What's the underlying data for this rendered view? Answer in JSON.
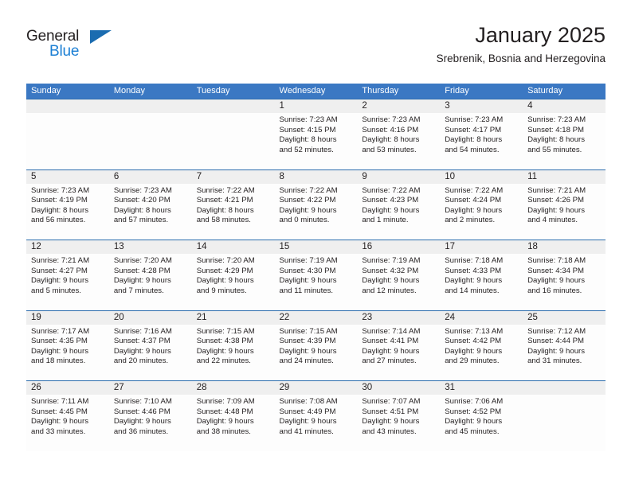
{
  "brand": {
    "name_part1": "General",
    "name_part2": "Blue",
    "accent_color": "#1b7fd4",
    "triangle_color": "#1b6cb0"
  },
  "header": {
    "month_title": "January 2025",
    "location": "Srebrenik, Bosnia and Herzegovina"
  },
  "theme": {
    "header_blue": "#3b78c3",
    "rule_blue": "#2b6cad",
    "daynum_band": "#efefef"
  },
  "weekdays": [
    "Sunday",
    "Monday",
    "Tuesday",
    "Wednesday",
    "Thursday",
    "Friday",
    "Saturday"
  ],
  "weeks": [
    {
      "days": [
        {
          "num": "",
          "lines": [
            "",
            "",
            "",
            ""
          ]
        },
        {
          "num": "",
          "lines": [
            "",
            "",
            "",
            ""
          ]
        },
        {
          "num": "",
          "lines": [
            "",
            "",
            "",
            ""
          ]
        },
        {
          "num": "1",
          "lines": [
            "Sunrise: 7:23 AM",
            "Sunset: 4:15 PM",
            "Daylight: 8 hours",
            "and 52 minutes."
          ]
        },
        {
          "num": "2",
          "lines": [
            "Sunrise: 7:23 AM",
            "Sunset: 4:16 PM",
            "Daylight: 8 hours",
            "and 53 minutes."
          ]
        },
        {
          "num": "3",
          "lines": [
            "Sunrise: 7:23 AM",
            "Sunset: 4:17 PM",
            "Daylight: 8 hours",
            "and 54 minutes."
          ]
        },
        {
          "num": "4",
          "lines": [
            "Sunrise: 7:23 AM",
            "Sunset: 4:18 PM",
            "Daylight: 8 hours",
            "and 55 minutes."
          ]
        }
      ]
    },
    {
      "days": [
        {
          "num": "5",
          "lines": [
            "Sunrise: 7:23 AM",
            "Sunset: 4:19 PM",
            "Daylight: 8 hours",
            "and 56 minutes."
          ]
        },
        {
          "num": "6",
          "lines": [
            "Sunrise: 7:23 AM",
            "Sunset: 4:20 PM",
            "Daylight: 8 hours",
            "and 57 minutes."
          ]
        },
        {
          "num": "7",
          "lines": [
            "Sunrise: 7:22 AM",
            "Sunset: 4:21 PM",
            "Daylight: 8 hours",
            "and 58 minutes."
          ]
        },
        {
          "num": "8",
          "lines": [
            "Sunrise: 7:22 AM",
            "Sunset: 4:22 PM",
            "Daylight: 9 hours",
            "and 0 minutes."
          ]
        },
        {
          "num": "9",
          "lines": [
            "Sunrise: 7:22 AM",
            "Sunset: 4:23 PM",
            "Daylight: 9 hours",
            "and 1 minute."
          ]
        },
        {
          "num": "10",
          "lines": [
            "Sunrise: 7:22 AM",
            "Sunset: 4:24 PM",
            "Daylight: 9 hours",
            "and 2 minutes."
          ]
        },
        {
          "num": "11",
          "lines": [
            "Sunrise: 7:21 AM",
            "Sunset: 4:26 PM",
            "Daylight: 9 hours",
            "and 4 minutes."
          ]
        }
      ]
    },
    {
      "days": [
        {
          "num": "12",
          "lines": [
            "Sunrise: 7:21 AM",
            "Sunset: 4:27 PM",
            "Daylight: 9 hours",
            "and 5 minutes."
          ]
        },
        {
          "num": "13",
          "lines": [
            "Sunrise: 7:20 AM",
            "Sunset: 4:28 PM",
            "Daylight: 9 hours",
            "and 7 minutes."
          ]
        },
        {
          "num": "14",
          "lines": [
            "Sunrise: 7:20 AM",
            "Sunset: 4:29 PM",
            "Daylight: 9 hours",
            "and 9 minutes."
          ]
        },
        {
          "num": "15",
          "lines": [
            "Sunrise: 7:19 AM",
            "Sunset: 4:30 PM",
            "Daylight: 9 hours",
            "and 11 minutes."
          ]
        },
        {
          "num": "16",
          "lines": [
            "Sunrise: 7:19 AM",
            "Sunset: 4:32 PM",
            "Daylight: 9 hours",
            "and 12 minutes."
          ]
        },
        {
          "num": "17",
          "lines": [
            "Sunrise: 7:18 AM",
            "Sunset: 4:33 PM",
            "Daylight: 9 hours",
            "and 14 minutes."
          ]
        },
        {
          "num": "18",
          "lines": [
            "Sunrise: 7:18 AM",
            "Sunset: 4:34 PM",
            "Daylight: 9 hours",
            "and 16 minutes."
          ]
        }
      ]
    },
    {
      "days": [
        {
          "num": "19",
          "lines": [
            "Sunrise: 7:17 AM",
            "Sunset: 4:35 PM",
            "Daylight: 9 hours",
            "and 18 minutes."
          ]
        },
        {
          "num": "20",
          "lines": [
            "Sunrise: 7:16 AM",
            "Sunset: 4:37 PM",
            "Daylight: 9 hours",
            "and 20 minutes."
          ]
        },
        {
          "num": "21",
          "lines": [
            "Sunrise: 7:15 AM",
            "Sunset: 4:38 PM",
            "Daylight: 9 hours",
            "and 22 minutes."
          ]
        },
        {
          "num": "22",
          "lines": [
            "Sunrise: 7:15 AM",
            "Sunset: 4:39 PM",
            "Daylight: 9 hours",
            "and 24 minutes."
          ]
        },
        {
          "num": "23",
          "lines": [
            "Sunrise: 7:14 AM",
            "Sunset: 4:41 PM",
            "Daylight: 9 hours",
            "and 27 minutes."
          ]
        },
        {
          "num": "24",
          "lines": [
            "Sunrise: 7:13 AM",
            "Sunset: 4:42 PM",
            "Daylight: 9 hours",
            "and 29 minutes."
          ]
        },
        {
          "num": "25",
          "lines": [
            "Sunrise: 7:12 AM",
            "Sunset: 4:44 PM",
            "Daylight: 9 hours",
            "and 31 minutes."
          ]
        }
      ]
    },
    {
      "days": [
        {
          "num": "26",
          "lines": [
            "Sunrise: 7:11 AM",
            "Sunset: 4:45 PM",
            "Daylight: 9 hours",
            "and 33 minutes."
          ]
        },
        {
          "num": "27",
          "lines": [
            "Sunrise: 7:10 AM",
            "Sunset: 4:46 PM",
            "Daylight: 9 hours",
            "and 36 minutes."
          ]
        },
        {
          "num": "28",
          "lines": [
            "Sunrise: 7:09 AM",
            "Sunset: 4:48 PM",
            "Daylight: 9 hours",
            "and 38 minutes."
          ]
        },
        {
          "num": "29",
          "lines": [
            "Sunrise: 7:08 AM",
            "Sunset: 4:49 PM",
            "Daylight: 9 hours",
            "and 41 minutes."
          ]
        },
        {
          "num": "30",
          "lines": [
            "Sunrise: 7:07 AM",
            "Sunset: 4:51 PM",
            "Daylight: 9 hours",
            "and 43 minutes."
          ]
        },
        {
          "num": "31",
          "lines": [
            "Sunrise: 7:06 AM",
            "Sunset: 4:52 PM",
            "Daylight: 9 hours",
            "and 45 minutes."
          ]
        },
        {
          "num": "",
          "lines": [
            "",
            "",
            "",
            ""
          ]
        }
      ]
    }
  ]
}
